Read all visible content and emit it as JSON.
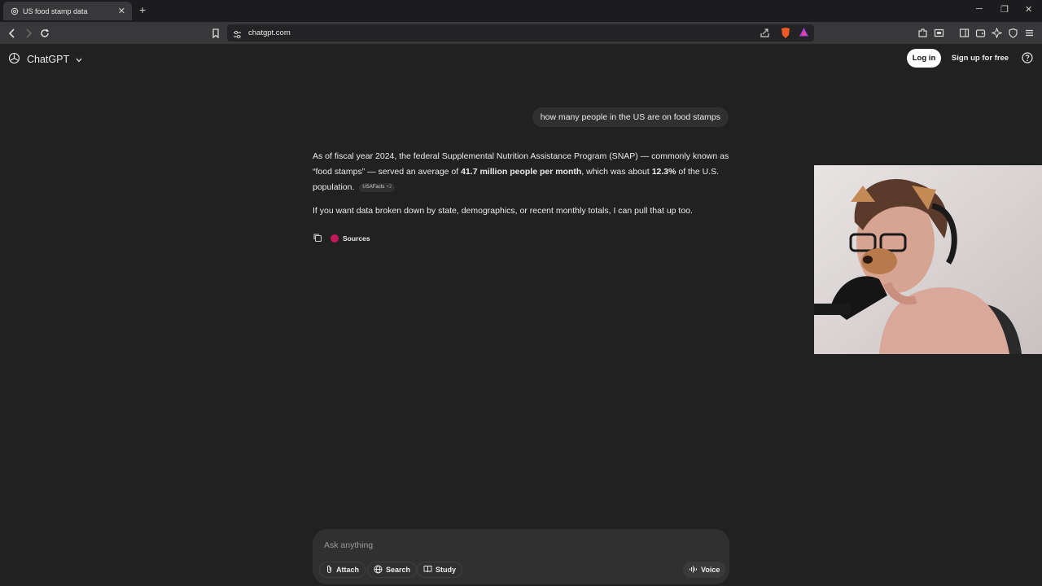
{
  "browser": {
    "tab_title": "US food stamp data",
    "url": "chatgpt.com"
  },
  "app": {
    "name": "ChatGPT",
    "login_label": "Log in",
    "signup_label": "Sign up for free"
  },
  "chat": {
    "user_message": "how many people in the US are on food stamps",
    "answer_p1_a": "As of fiscal year 2024, the federal Supplemental Nutrition Assistance Program (SNAP) — commonly known as “food stamps” — served an average of ",
    "answer_p1_bold1": "41.7 million people per month",
    "answer_p1_b": ", which was about ",
    "answer_p1_bold2": "12.3%",
    "answer_p1_c": " of the U.S. population.",
    "citation_label": "USAFacts",
    "citation_extra": "+2",
    "answer_p2": "If you want data broken down by state, demographics, or recent monthly totals, I can pull that up too.",
    "sources_label": "Sources"
  },
  "composer": {
    "placeholder": "Ask anything",
    "attach_label": "Attach",
    "search_label": "Search",
    "study_label": "Study",
    "voice_label": "Voice"
  },
  "colors": {
    "background": "#212121",
    "bubble": "#303030",
    "source_dot": "#c2185b"
  }
}
